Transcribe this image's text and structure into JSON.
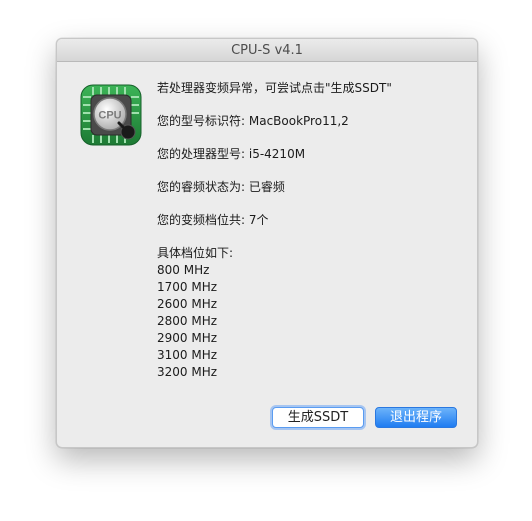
{
  "window": {
    "title": "CPU-S v4.1"
  },
  "app_icon": {
    "name": "cpu-chip-icon",
    "label": "CPU",
    "colors": {
      "board_green": "#2fa24a",
      "board_dark": "#1d7a34",
      "chip_silver": "#d9d9d9"
    }
  },
  "message": {
    "hint": "若处理器变频异常，可尝试点击\"生成SSDT\"",
    "model_label": "您的型号标识符: ",
    "model_value": "MacBookPro11,2",
    "cpu_label": "您的处理器型号: ",
    "cpu_value": "i5-4210M",
    "turbo_label": "您的睿频状态为: ",
    "turbo_value": "已睿频",
    "pstates_label": "您的变频档位共: ",
    "pstates_value": "7个",
    "freq_header": "具体档位如下:",
    "frequencies": [
      "800 MHz",
      "1700 MHz",
      "2600 MHz",
      "2800 MHz",
      "2900 MHz",
      "3100 MHz",
      "3200 MHz"
    ]
  },
  "buttons": {
    "generate_ssdt": "生成SSDT",
    "exit": "退出程序"
  },
  "colors": {
    "accent_blue": "#1f7cf1",
    "window_bg": "#ececec"
  }
}
